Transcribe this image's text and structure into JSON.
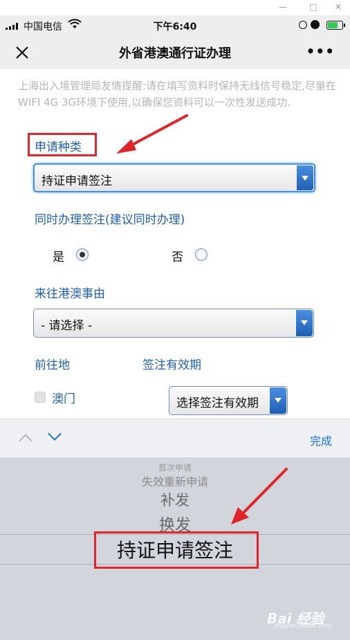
{
  "status_bar": {
    "carrier": "中国电信",
    "time": "下午6:40",
    "battery_level": 0.7,
    "battery_color": "#34c759"
  },
  "nav": {
    "title": "外省港澳通行证办理",
    "more_label": "•••",
    "close_icon": "close-icon"
  },
  "notice": "上海出入境管理局友情提醒:请在填写资料时保持无线信号稳定,尽量在WIFI 4G 3G环境下使用,以确保您资料可以一次性发送成功.",
  "form": {
    "apply_type_label": "申请种类",
    "apply_type_value": "持证申请签注",
    "simultaneous_label": "同时办理签注(建议同时办理)",
    "yes_label": "是",
    "no_label": "否",
    "reason_label": "来往港澳事由",
    "reason_value": "- 请选择 -",
    "destination_label": "前往地",
    "validity_label": "签注有效期",
    "macau_label": "澳门",
    "validity_value": "选择签注有效期"
  },
  "toolbar": {
    "done_label": "完成"
  },
  "picker": {
    "options": [
      "首次申请",
      "失效重新申请",
      "补发",
      "换发",
      "持证申请签注"
    ],
    "selected_index": 4
  },
  "watermark": {
    "text": "Bai 经验",
    "sub": "jingyan.baidu.com"
  },
  "colors": {
    "accent": "#1f5fb4",
    "highlight": "#e0252a",
    "done": "#1f6fd8"
  }
}
